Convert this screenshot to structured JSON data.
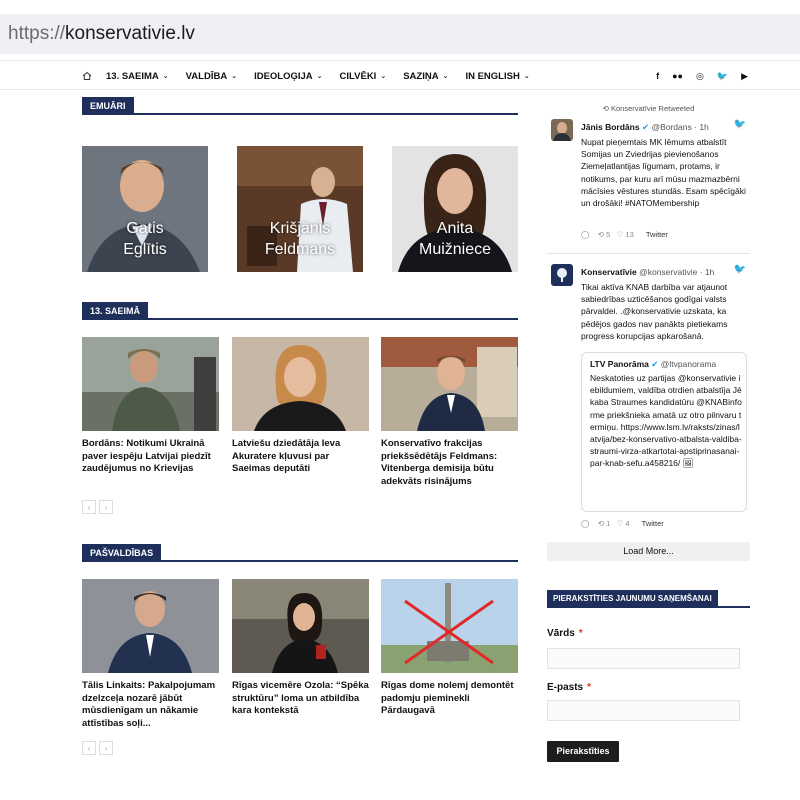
{
  "url": {
    "protocol": "https://",
    "host": "konservativie.lv"
  },
  "nav": {
    "items": [
      {
        "label": "13. SAEIMA"
      },
      {
        "label": "VALDĪBA"
      },
      {
        "label": "IDEOLOĢIJA"
      },
      {
        "label": "CILVĒKI"
      },
      {
        "label": "SAZIŅA"
      },
      {
        "label": "IN ENGLISH"
      }
    ],
    "social_icons": [
      "facebook-icon",
      "flickr-icon",
      "instagram-icon",
      "twitter-icon",
      "youtube-icon"
    ]
  },
  "sections": {
    "emuari": "EMUĀRI",
    "saeima": "13. SAEIMĀ",
    "pasvaldibas": "PAŠVALDĪBAS"
  },
  "meps": [
    {
      "name_line1": "Gatis",
      "name_line2": "Eglītis"
    },
    {
      "name_line1": "Krišjānis",
      "name_line2": "Feldmans"
    },
    {
      "name_line1": "Anita",
      "name_line2": "Muižniece"
    }
  ],
  "saeima_articles": [
    {
      "title": "Bordāns: Notikumi Ukrainā paver iespēju Latvijai piedzīt zaudējumus no Krievijas"
    },
    {
      "title": "Latviešu dziedātāja Ieva Akuratere kļuvusi par Saeimas deputāti"
    },
    {
      "title": "Konservatīvo frakcijas priekšsēdētājs Feldmans: Vitenberga demisija būtu adekvāts risinājums"
    }
  ],
  "pasvaldibas_articles": [
    {
      "title": "Tālis Linkaits: Pakalpojumam dzelzceļa nozarē jābūt mūsdienīgam un nākamie attīstības soļi..."
    },
    {
      "title": "Rīgas vicemēre Ozola: “Spēka struktūru” loma un atbildība kara kontekstā"
    },
    {
      "title": "Rīgas dome nolemj demontēt padomju pieminekli Pārdaugavā"
    }
  ],
  "pager": {
    "prev": "‹",
    "next": "›"
  },
  "twitter": {
    "retweeted": "Konservatīvie Retweeted",
    "tweets": [
      {
        "author": "Jānis Bordāns",
        "handle": "@Bordans",
        "time": "· 1h",
        "text": "Nupat pieņemtais MK lēmums atbalstīt Somijas un Zviedrijas pievienošanos Ziemeļatlantijas līgumam, protams, ir notikums, par kuru arī mūsu mazmazbērni mācīsies vēstures stundās. Esam spēcīgāki un drošāki! #NATOMembership",
        "retweets": "5",
        "likes": "13",
        "source": "Twitter"
      },
      {
        "author": "Konservatīvie",
        "handle": "@konservativie",
        "time": "· 1h",
        "text": "Tikai aktīva KNAB darbība var atjaunot sabiedrības uzticēšanos godīgai valsts pārvaldei. .@konservativie uzskata, ka pēdējos gados nav panākts pietiekams progress korupcijas apkarošanā.",
        "retweets": "1",
        "likes": "4",
        "source": "Twitter"
      }
    ],
    "quote": {
      "author": "LTV Panorāma",
      "handle": "@ltvpanorama",
      "text": "Neskatoties uz partijas @konservativie iebildumiem, valdība otrdien atbalstīja Jēkaba Straumes kandidatūru @KNABinforme priekšnieka amatā uz otro pilnvaru termiņu. https://www.lsm.lv/raksts/zinas/latvija/bez-konservativo-atbalsta-valdiba-straumi-virza-atkartotai-apstiprinasanai-par-knab-sefu.a458216/"
    },
    "load_more": "Load More..."
  },
  "subscribe": {
    "heading": "PIERAKSTĪTIES JAUNUMU SAŅEMŠANAI",
    "name_label": "Vārds",
    "email_label": "E-pasts",
    "required_mark": "*",
    "button": "Pierakstīties"
  }
}
